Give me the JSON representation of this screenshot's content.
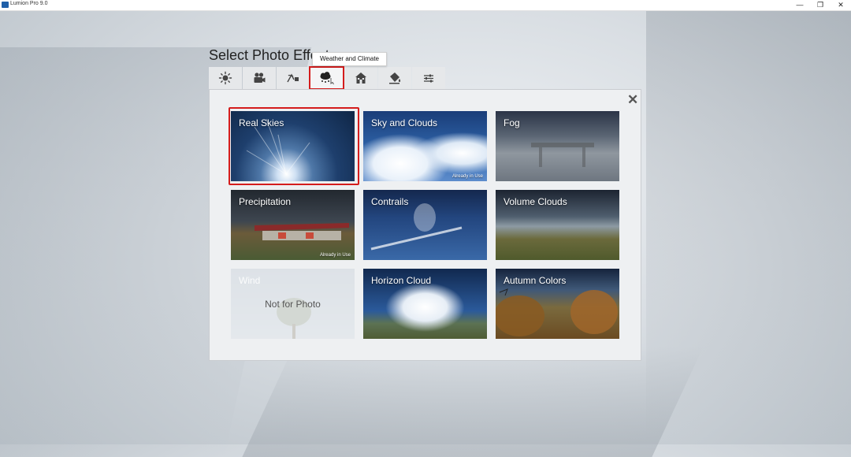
{
  "window": {
    "title": "Lumion Pro 9.0",
    "controls": {
      "minimize": "—",
      "maximize": "❐",
      "close": "✕"
    }
  },
  "page_title": "Select Photo Effect",
  "tooltip": "Weather and Climate",
  "tabs": [
    {
      "icon": "sun-icon",
      "active": false
    },
    {
      "icon": "camera-icon",
      "active": false
    },
    {
      "icon": "artistic-icon",
      "active": false
    },
    {
      "icon": "weather-icon",
      "active": true
    },
    {
      "icon": "house-icon",
      "active": false
    },
    {
      "icon": "paint-bucket-icon",
      "active": false
    },
    {
      "icon": "sliders-icon",
      "active": false
    }
  ],
  "panel": {
    "close_icon": "close-icon",
    "effects": [
      {
        "label": "Real Skies",
        "badge": "",
        "selected": true
      },
      {
        "label": "Sky and Clouds",
        "badge": "Already in Use"
      },
      {
        "label": "Fog",
        "badge": ""
      },
      {
        "label": "Precipitation",
        "badge": "Already in Use"
      },
      {
        "label": "Contrails",
        "badge": ""
      },
      {
        "label": "Volume Clouds",
        "badge": ""
      },
      {
        "label": "Wind",
        "badge": "",
        "note": "Not for Photo",
        "disabled": true
      },
      {
        "label": "Horizon Cloud",
        "badge": ""
      },
      {
        "label": "Autumn Colors",
        "badge": ""
      }
    ]
  },
  "colors": {
    "highlight": "#d41c1c",
    "panel_bg": "#eef0f2"
  }
}
